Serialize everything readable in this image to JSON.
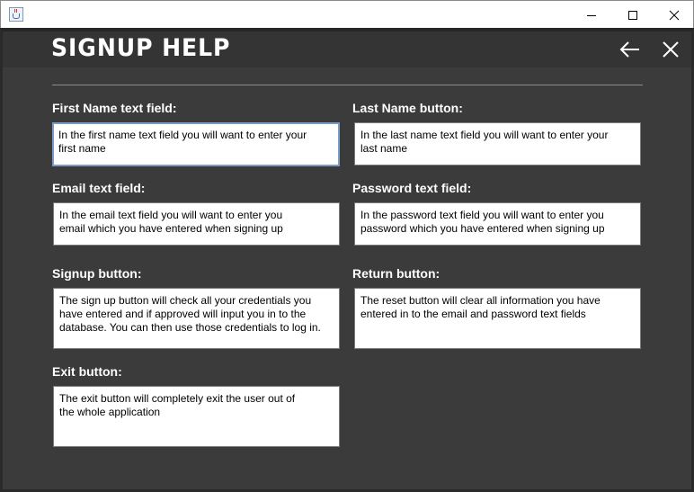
{
  "window": {
    "minimize_icon": "minimize-icon",
    "maximize_icon": "maximize-icon",
    "close_icon": "close-icon"
  },
  "header": {
    "title": "SIGNUP HELP",
    "back_icon": "arrow-left-icon",
    "close_icon": "close-icon"
  },
  "colors": {
    "panel_bg": "#3b3b3b",
    "header_bg": "#343434",
    "text": "#ffffff",
    "focus_border": "#7a9cc6"
  },
  "items": [
    {
      "label": "First Name text field:",
      "description": "In the first name text field you will want to enter your\nfirst name"
    },
    {
      "label": "Last Name button:",
      "description": "In the last name text field you will want to enter your\nlast name"
    },
    {
      "label": "Email text field:",
      "description": "In the email text field you will want to enter you\nemail which you have entered when signing up"
    },
    {
      "label": "Password text field:",
      "description": "In the password text field you will want to enter you\npassword which you have entered when signing up"
    },
    {
      "label": "Signup button:",
      "description": "The sign up button will check all your credentials you\nhave entered and if approved will input you in to the\ndatabase. You can then use those credentials to log in."
    },
    {
      "label": "Return button:",
      "description": "The reset button will clear all information you have\nentered in to the email and password text fields"
    },
    {
      "label": "Exit button:",
      "description": "The exit button will completely exit the user out of\n the whole application"
    }
  ]
}
